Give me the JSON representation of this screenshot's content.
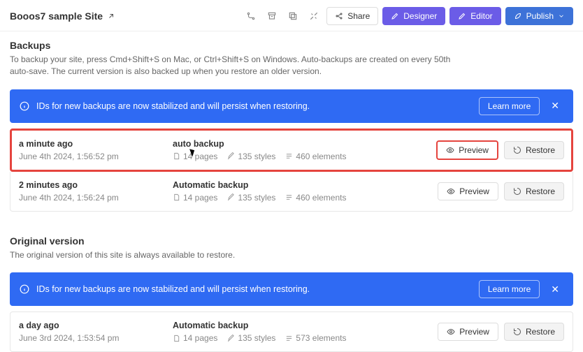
{
  "header": {
    "site_name": "Booos7 sample Site",
    "share": "Share",
    "designer": "Designer",
    "editor": "Editor",
    "publish": "Publish"
  },
  "backups": {
    "title": "Backups",
    "desc": "To backup your site, press Cmd+Shift+S on Mac, or Ctrl+Shift+S on Windows. Auto-backups are created on every 50th auto-save. The current version is also backed up when you restore an older version."
  },
  "banner": {
    "text": "IDs for new backups are now stabilized and will persist when restoring.",
    "learn": "Learn more"
  },
  "rows": {
    "r0": {
      "rel": "a minute ago",
      "abs": "June 4th 2024, 1:56:52 pm",
      "name": "auto backup",
      "pages": "14 pages",
      "styles": "135 styles",
      "elements": "460 elements",
      "preview": "Preview",
      "restore": "Restore"
    },
    "r1": {
      "rel": "2 minutes ago",
      "abs": "June 4th 2024, 1:56:24 pm",
      "name": "Automatic backup",
      "pages": "14 pages",
      "styles": "135 styles",
      "elements": "460 elements",
      "preview": "Preview",
      "restore": "Restore"
    }
  },
  "original": {
    "title": "Original version",
    "desc": "The original version of this site is always available to restore."
  },
  "orig_row": {
    "rel": "a day ago",
    "abs": "June 3rd 2024, 1:53:54 pm",
    "name": "Automatic backup",
    "pages": "14 pages",
    "styles": "135 styles",
    "elements": "573 elements",
    "preview": "Preview",
    "restore": "Restore"
  }
}
